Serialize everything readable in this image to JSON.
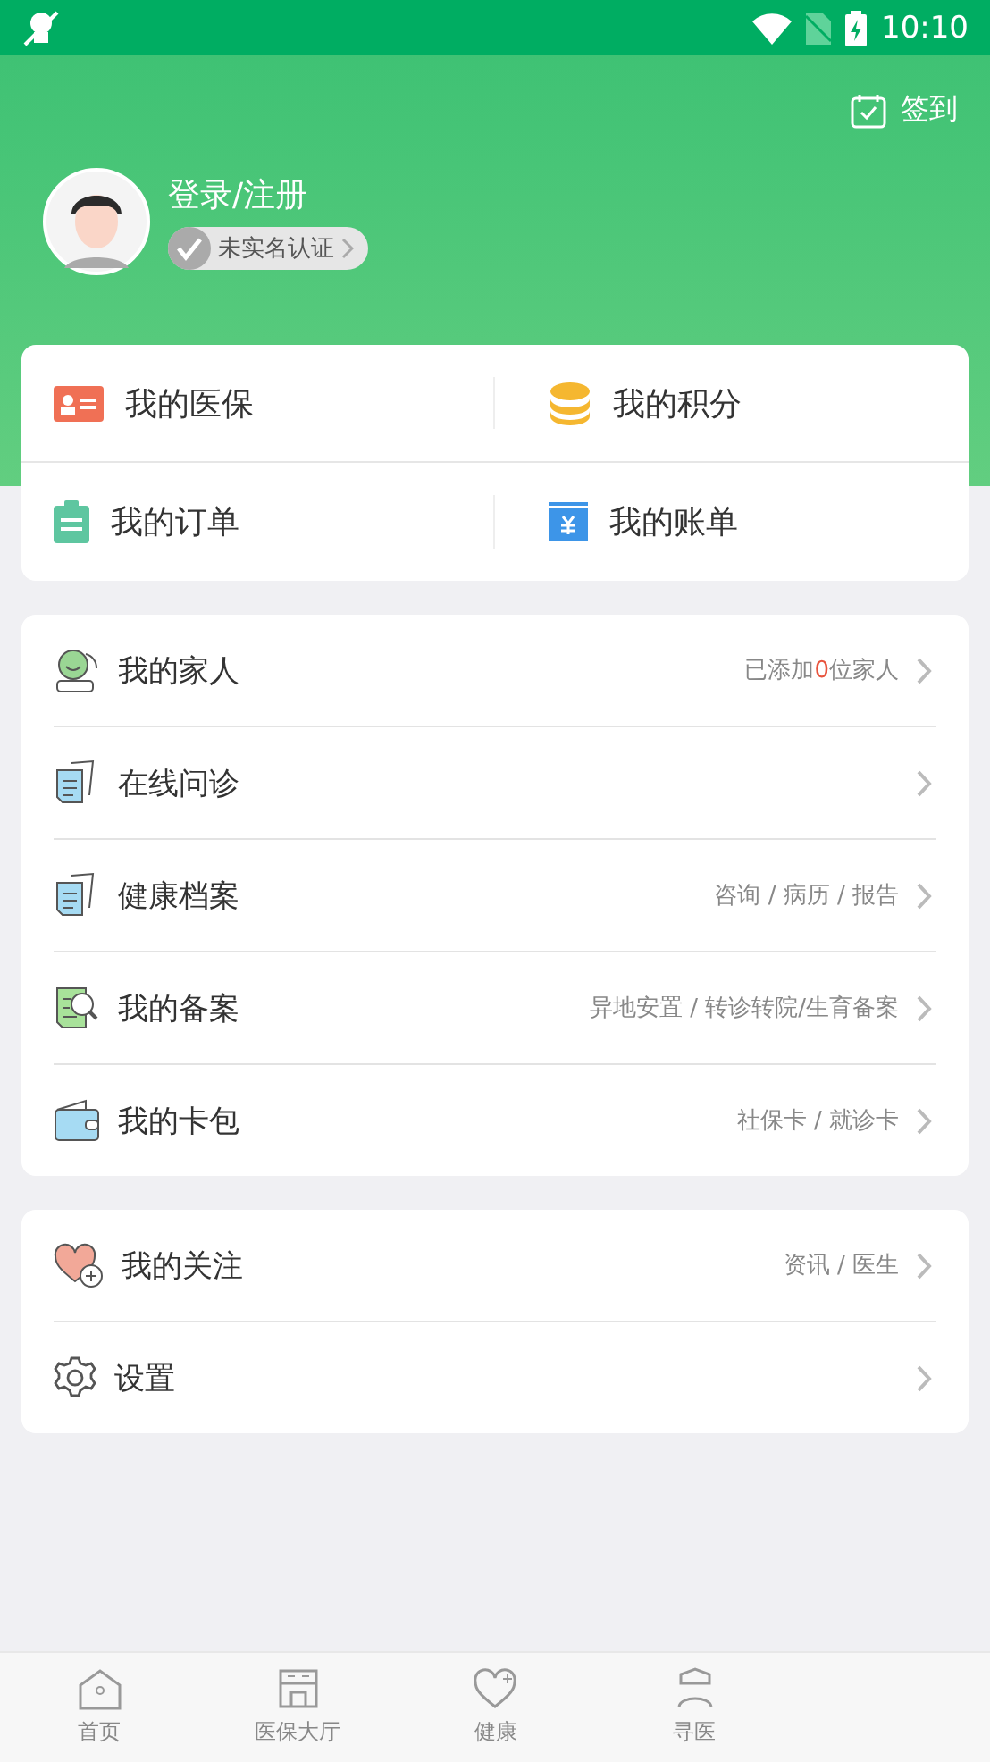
{
  "status_bar": {
    "time": "10:10"
  },
  "header": {
    "sign_in": "签到",
    "user_name": "登录/注册",
    "verify_badge": "未实名认证"
  },
  "quick_grid": [
    {
      "label": "我的医保"
    },
    {
      "label": "我的积分"
    },
    {
      "label": "我的订单"
    },
    {
      "label": "我的账单"
    }
  ],
  "menu_groups": [
    {
      "items": [
        {
          "label": "我的家人",
          "note": [
            {
              "text": "已添加",
              "highlight": false
            },
            {
              "text": "0",
              "highlight": true
            },
            {
              "text": "位家人",
              "highlight": false
            }
          ]
        },
        {
          "label": "在线问诊"
        },
        {
          "label": "健康档案",
          "note": [
            {
              "text": "咨询 / 病历 / 报告",
              "highlight": false
            }
          ]
        },
        {
          "label": "我的备案",
          "note": [
            {
              "text": "异地安置 / 转诊转院/生育备案",
              "highlight": false
            }
          ]
        },
        {
          "label": "我的卡包",
          "note": [
            {
              "text": "社保卡 / 就诊卡",
              "highlight": false
            }
          ]
        }
      ]
    },
    {
      "items": [
        {
          "label": "我的关注",
          "note": [
            {
              "text": "资讯 / 医生",
              "highlight": false
            }
          ]
        },
        {
          "label": "设置"
        }
      ]
    }
  ],
  "bottom_nav": [
    {
      "label": "首页"
    },
    {
      "label": "医保大厅"
    },
    {
      "label": "健康"
    },
    {
      "label": "寻医"
    }
  ]
}
